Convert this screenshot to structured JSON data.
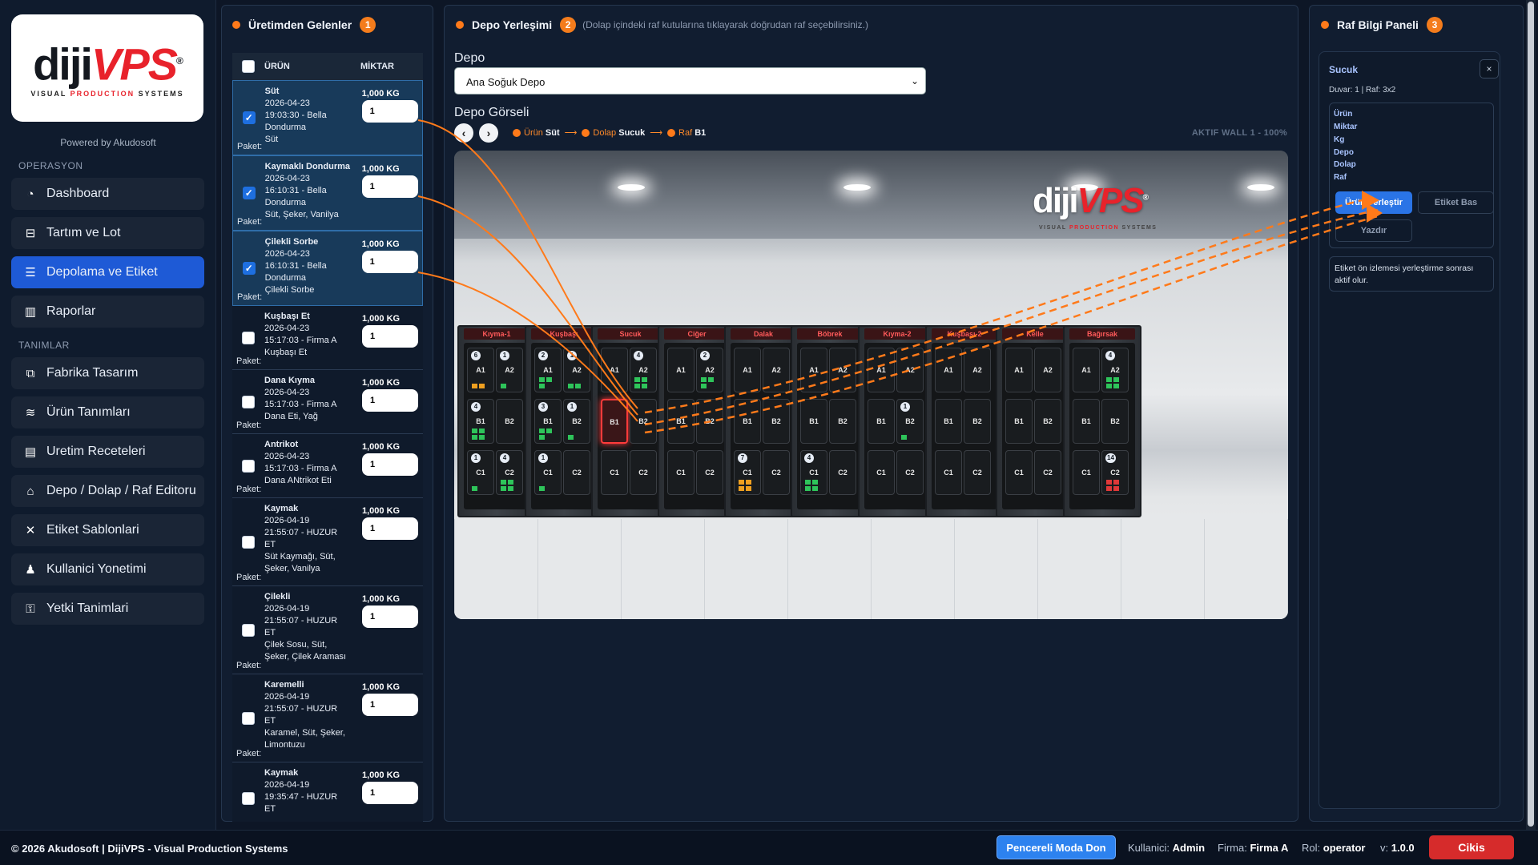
{
  "brand": {
    "logo_left": "diji",
    "logo_right": "VPS",
    "logo_reg": "®",
    "logo_sub_a": "VISUAL ",
    "logo_sub_b": "PRODUCTION",
    "logo_sub_c": " SYSTEMS",
    "powered": "Powered by Akudosoft"
  },
  "sidebar": {
    "section_ops": "OPERASYON",
    "section_defs": "TANIMLAR",
    "items": [
      {
        "label": "Dashboard",
        "icon": "dashboard-icon"
      },
      {
        "label": "Tartım ve Lot",
        "icon": "scale-icon"
      },
      {
        "label": "Depolama ve Etiket",
        "icon": "list-icon",
        "active": true
      },
      {
        "label": "Raporlar",
        "icon": "chart-icon"
      },
      {
        "label": "Fabrika Tasarım",
        "icon": "sitemap-icon"
      },
      {
        "label": "Ürün Tanımları",
        "icon": "layers-icon"
      },
      {
        "label": "Uretim Receteleri",
        "icon": "book-icon"
      },
      {
        "label": "Depo / Dolap / Raf Editoru",
        "icon": "warehouse-icon"
      },
      {
        "label": "Etiket Sablonlari",
        "icon": "tools-icon"
      },
      {
        "label": "Kullanici Yonetimi",
        "icon": "users-icon"
      },
      {
        "label": "Yetki Tanimlari",
        "icon": "user-lock-icon"
      }
    ]
  },
  "production": {
    "title": "Üretimden Gelenler",
    "badge": "1",
    "col_product": "ÜRÜN",
    "col_qty": "MİKTAR",
    "pkg_label": "Paket:",
    "rows": [
      {
        "name": "Süt",
        "date": "2026-04-23",
        "time": "19:03:30 - Bella",
        "l3": "Dondurma",
        "l4": "Süt",
        "l5": "",
        "qty": "1,000 KG",
        "pkg": "1",
        "checked": true
      },
      {
        "name": "Kaymaklı Dondurma",
        "date": "2026-04-23",
        "time": "16:10:31 - Bella",
        "l3": "Dondurma",
        "l4": "Süt, Şeker, Vanilya",
        "l5": "",
        "qty": "1,000 KG",
        "pkg": "1",
        "checked": true
      },
      {
        "name": "Çilekli Sorbe",
        "date": "2026-04-23",
        "time": "16:10:31 - Bella",
        "l3": "Dondurma",
        "l4": "Çilekli Sorbe",
        "l5": "",
        "qty": "1,000 KG",
        "pkg": "1",
        "checked": true
      },
      {
        "name": "Kuşbaşı Et",
        "date": "2026-04-23",
        "time": "15:17:03 - Firma A",
        "l3": "Kuşbaşı Et",
        "l4": "",
        "l5": "",
        "qty": "1,000 KG",
        "pkg": "1",
        "checked": false
      },
      {
        "name": "Dana Kıyma",
        "date": "2026-04-23",
        "time": "15:17:03 - Firma A",
        "l3": "Dana Eti, Yağ",
        "l4": "",
        "l5": "",
        "qty": "1,000 KG",
        "pkg": "1",
        "checked": false
      },
      {
        "name": "Antrikot",
        "date": "2026-04-23",
        "time": "15:17:03 - Firma A",
        "l3": "Dana ANtrikot Eti",
        "l4": "",
        "l5": "",
        "qty": "1,000 KG",
        "pkg": "1",
        "checked": false
      },
      {
        "name": "Kaymak",
        "date": "2026-04-19",
        "time": "21:55:07 - HUZUR",
        "l3": "ET",
        "l4": "Süt Kaymağı, Süt,",
        "l5": "Şeker, Vanilya",
        "qty": "1,000 KG",
        "pkg": "1",
        "checked": false
      },
      {
        "name": "Çilekli",
        "date": "2026-04-19",
        "time": "21:55:07 - HUZUR",
        "l3": "ET",
        "l4": "Çilek Sosu, Süt,",
        "l5": "Şeker, Çilek Araması",
        "qty": "1,000 KG",
        "pkg": "1",
        "checked": false
      },
      {
        "name": "Karemelli",
        "date": "2026-04-19",
        "time": "21:55:07 - HUZUR",
        "l3": "ET",
        "l4": "Karamel, Süt, Şeker,",
        "l5": "Limontuzu",
        "qty": "1,000 KG",
        "pkg": "1",
        "checked": false
      },
      {
        "name": "Kaymak",
        "date": "2026-04-19",
        "time": "19:35:47 - HUZUR",
        "l3": "ET",
        "l4": "",
        "l5": "",
        "qty": "1,000 KG",
        "pkg": "1",
        "checked": false
      }
    ]
  },
  "placement": {
    "title": "Depo Yerleşimi",
    "badge": "2",
    "hint": "(Dolap içindeki raf kutularına tıklayarak doğrudan raf seçebilirsiniz.)",
    "depot_label": "Depo",
    "depot_value": "Ana Soğuk Depo",
    "visual_label": "Depo Görseli",
    "crumb_product_k": "Ürün",
    "crumb_product_v": "Süt",
    "crumb_cabinet_k": "Dolap",
    "crumb_cabinet_v": "Sucuk",
    "crumb_shelf_k": "Raf",
    "crumb_shelf_v": "B1",
    "wall_status": "AKTIF WALL 1 - 100%",
    "scene_logo_left": "diji",
    "scene_logo_right": "VPS",
    "scene_logo_reg": "®",
    "scene_logo_sub_a": "VISUAL ",
    "scene_logo_sub_b": "PRODUCTION",
    "scene_logo_sub_c": " SYSTEMS",
    "cabinets": [
      {
        "name": "Kıyma-1",
        "shelves": [
          {
            "l": "A1",
            "b": "6",
            "p": "o",
            "n": 2
          },
          {
            "l": "A2",
            "b": "1",
            "p": "g",
            "n": 1
          },
          {
            "l": "B1",
            "b": "4",
            "p": "g",
            "n": 4
          },
          {
            "l": "B2"
          },
          {
            "l": "C1",
            "b": "1",
            "p": "g",
            "n": 1
          },
          {
            "l": "C2",
            "b": "4",
            "p": "g",
            "n": 4
          }
        ]
      },
      {
        "name": "Kuşbaşı",
        "shelves": [
          {
            "l": "A1",
            "b": "2",
            "p": "g",
            "n": 3
          },
          {
            "l": "A2",
            "b": "1",
            "p": "g",
            "n": 2
          },
          {
            "l": "B1",
            "b": "3",
            "p": "g",
            "n": 3
          },
          {
            "l": "B2",
            "b": "1",
            "p": "g",
            "n": 1
          },
          {
            "l": "C1",
            "b": "1",
            "p": "g",
            "n": 1
          },
          {
            "l": "C2"
          }
        ]
      },
      {
        "name": "Sucuk",
        "shelves": [
          {
            "l": "A1"
          },
          {
            "l": "A2",
            "b": "4",
            "p": "g",
            "n": 4
          },
          {
            "l": "B1",
            "hl": true
          },
          {
            "l": "B2"
          },
          {
            "l": "C1"
          },
          {
            "l": "C2"
          }
        ]
      },
      {
        "name": "Ciğer",
        "shelves": [
          {
            "l": "A1"
          },
          {
            "l": "A2",
            "b": "2",
            "p": "g",
            "n": 3
          },
          {
            "l": "B1"
          },
          {
            "l": "B2"
          },
          {
            "l": "C1"
          },
          {
            "l": "C2"
          }
        ]
      },
      {
        "name": "Dalak",
        "shelves": [
          {
            "l": "A1"
          },
          {
            "l": "A2"
          },
          {
            "l": "B1"
          },
          {
            "l": "B2"
          },
          {
            "l": "C1",
            "b": "7",
            "p": "o",
            "n": 4
          },
          {
            "l": "C2"
          }
        ]
      },
      {
        "name": "Böbrek",
        "shelves": [
          {
            "l": "A1"
          },
          {
            "l": "A2"
          },
          {
            "l": "B1"
          },
          {
            "l": "B2"
          },
          {
            "l": "C1",
            "b": "4",
            "p": "g",
            "n": 4
          },
          {
            "l": "C2"
          }
        ]
      },
      {
        "name": "Kıyma-2",
        "shelves": [
          {
            "l": "A1"
          },
          {
            "l": "A2"
          },
          {
            "l": "B1"
          },
          {
            "l": "B2",
            "b": "1",
            "p": "g",
            "n": 1
          },
          {
            "l": "C1"
          },
          {
            "l": "C2"
          }
        ]
      },
      {
        "name": "Kuşbaşı-2",
        "shelves": [
          {
            "l": "A1"
          },
          {
            "l": "A2"
          },
          {
            "l": "B1"
          },
          {
            "l": "B2"
          },
          {
            "l": "C1"
          },
          {
            "l": "C2"
          }
        ]
      },
      {
        "name": "Kelle",
        "shelves": [
          {
            "l": "A1"
          },
          {
            "l": "A2"
          },
          {
            "l": "B1"
          },
          {
            "l": "B2"
          },
          {
            "l": "C1"
          },
          {
            "l": "C2"
          }
        ]
      },
      {
        "name": "Bağırsak",
        "shelves": [
          {
            "l": "A1"
          },
          {
            "l": "A2",
            "b": "4",
            "p": "g",
            "n": 4
          },
          {
            "l": "B1"
          },
          {
            "l": "B2"
          },
          {
            "l": "C1"
          },
          {
            "l": "C2",
            "b": "14",
            "p": "r",
            "n": 4
          }
        ]
      }
    ]
  },
  "info": {
    "title": "Raf Bilgi Paneli",
    "badge": "3",
    "selected": "Sucuk",
    "meta": "Duvar: 1 | Raf: 3x2",
    "fields": [
      "Ürün",
      "Miktar",
      "Kg",
      "Depo",
      "Dolap",
      "Raf"
    ],
    "btn_place": "Ürün Yerleştir",
    "btn_label": "Etiket Bas",
    "btn_print": "Yazdır",
    "note": "Etiket ön izlemesi yerleştirme sonrası aktif olur.",
    "close": "×"
  },
  "footer": {
    "copyright": "© 2026 Akudosoft | DijiVPS - Visual Production Systems",
    "window_mode": "Pencereli Moda Don",
    "user_k": "Kullanici:",
    "user_v": "Admin",
    "firm_k": "Firma:",
    "firm_v": "Firma A",
    "role_k": "Rol:",
    "role_v": "operator",
    "ver_k": "v:",
    "ver_v": "1.0.0",
    "exit": "Cikis"
  },
  "colors": {
    "accent": "#1e5ad6",
    "orange": "#ff7a1a",
    "danger": "#d62b2b",
    "package_green": "#2ec45a",
    "package_orange": "#f0a020",
    "package_red": "#e03838"
  }
}
